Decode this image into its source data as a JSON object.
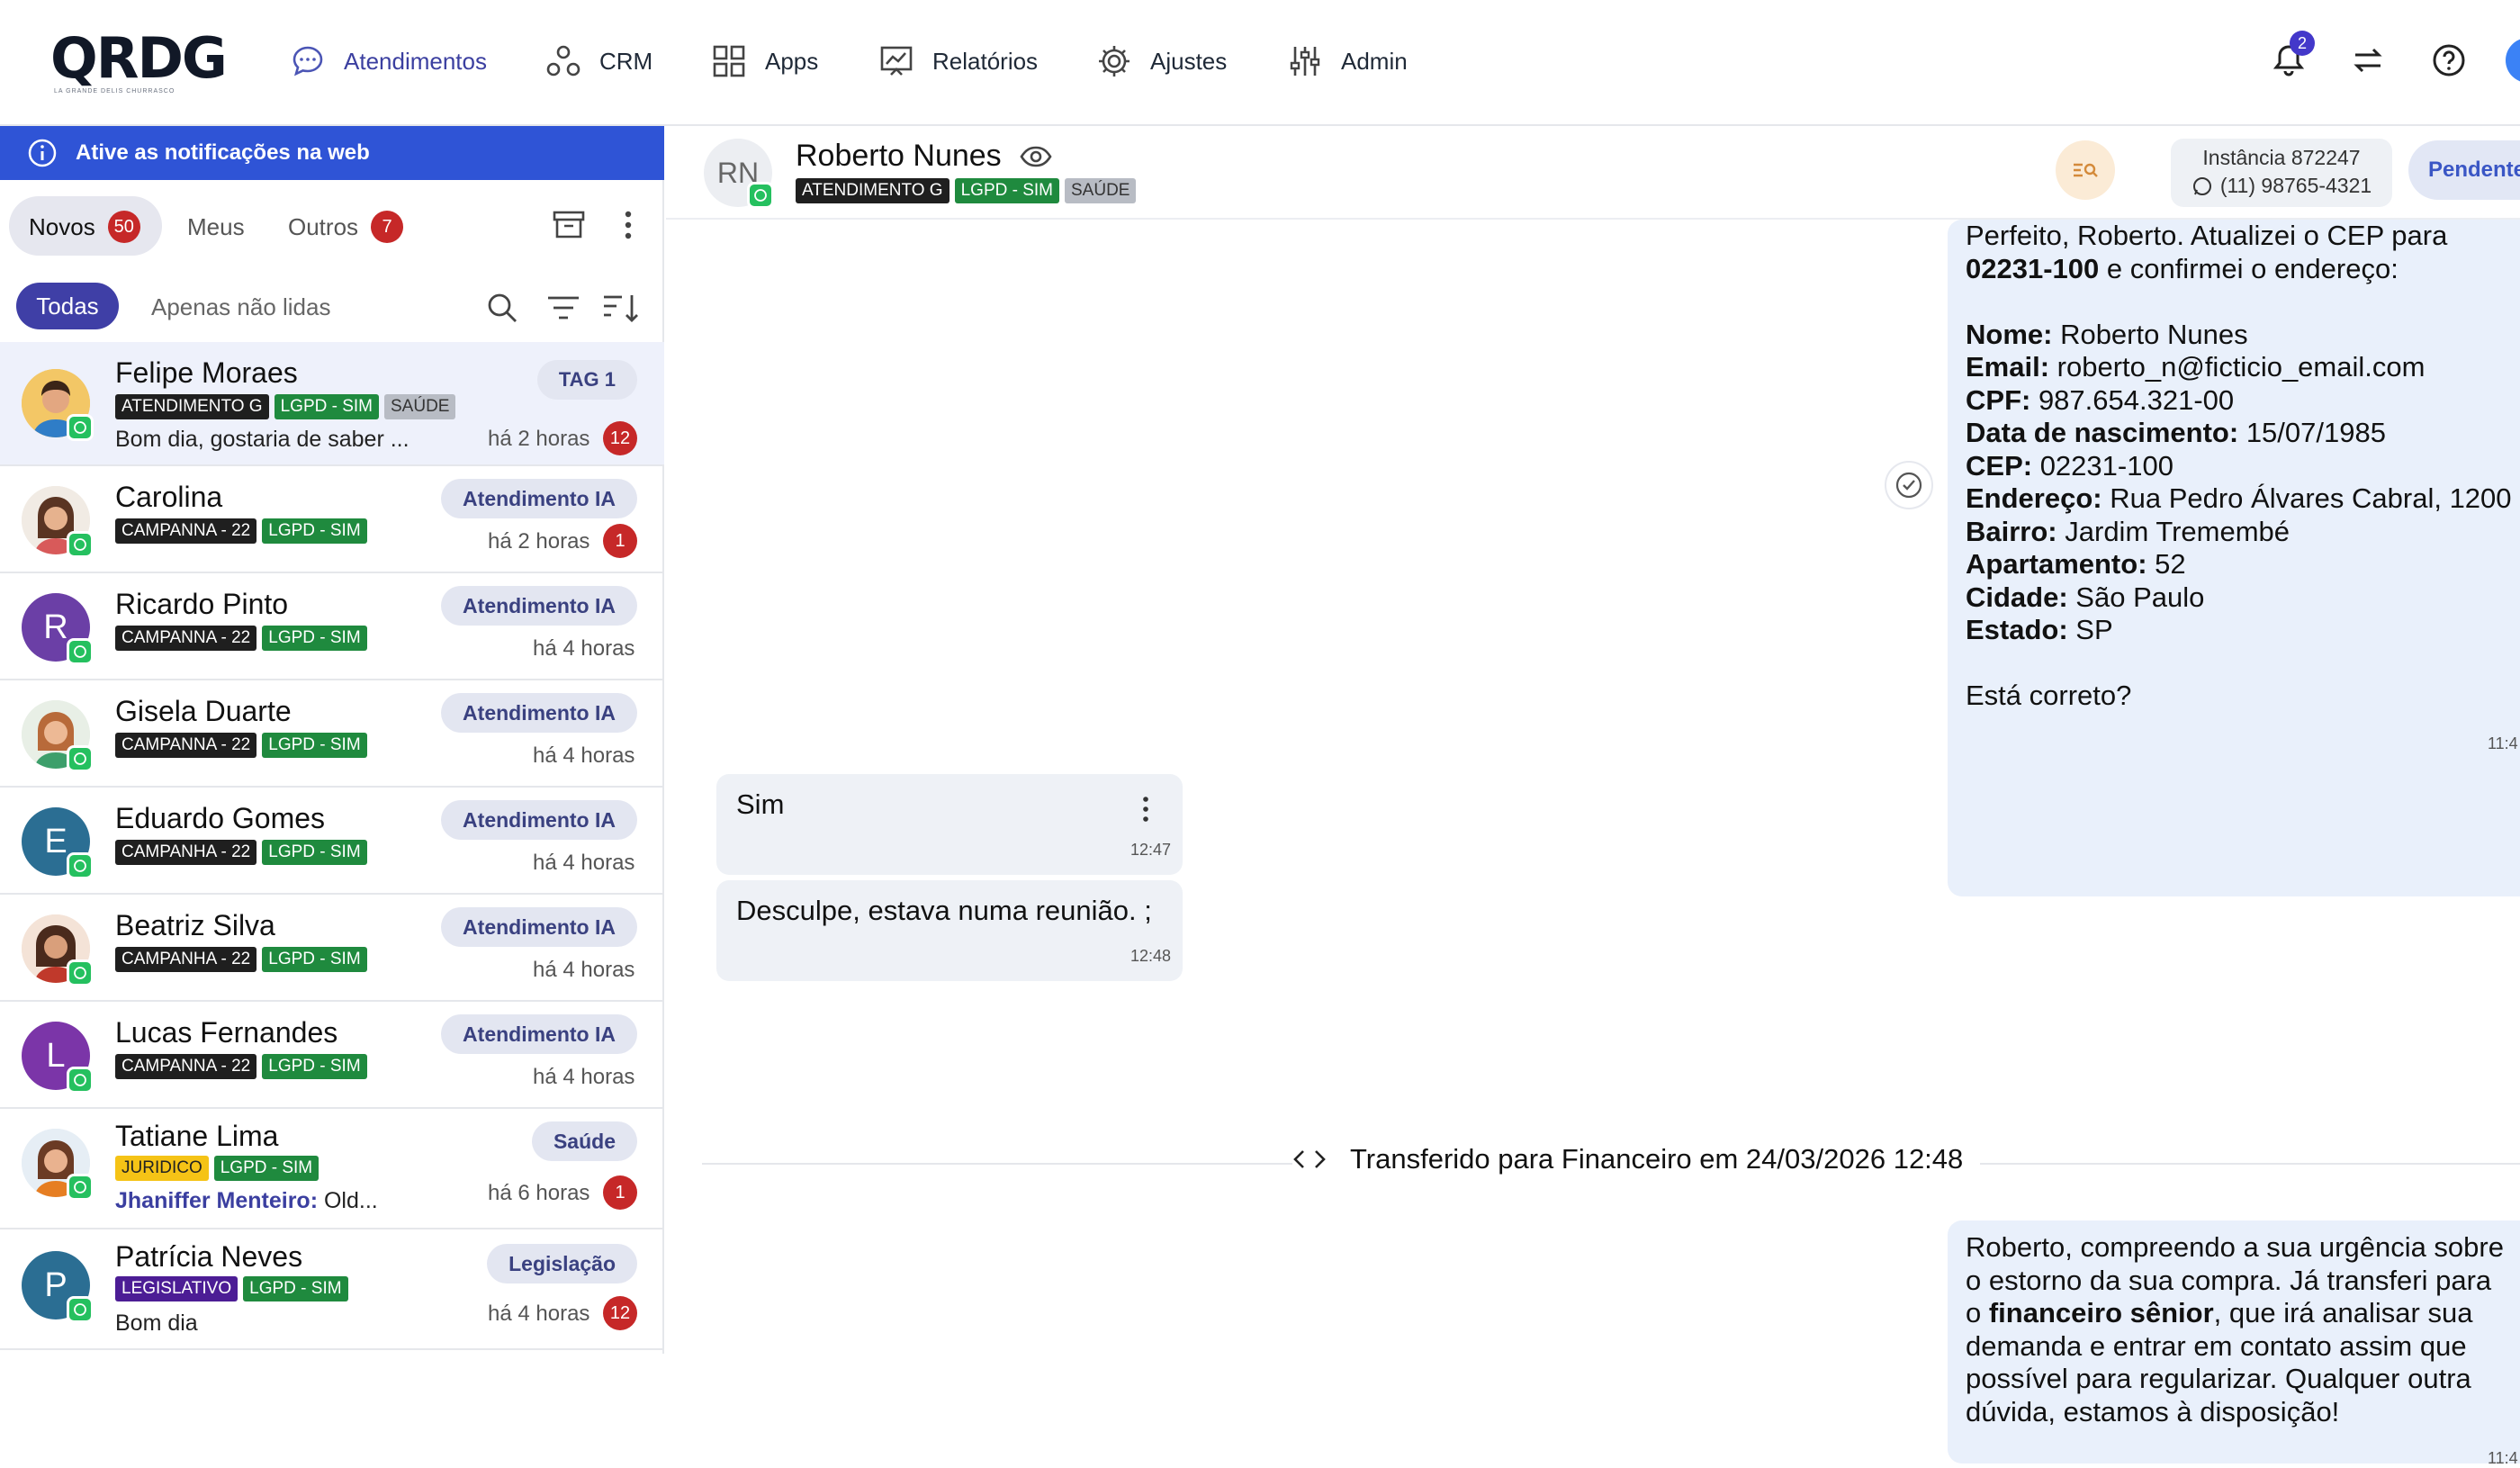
{
  "brand": {
    "logo_text": "QRDG",
    "logo_sub": "LA GRANDE DELIS CHURRASCO"
  },
  "nav": {
    "items": [
      {
        "label": "Atendimentos",
        "icon": "chat-bubble-icon",
        "active": true
      },
      {
        "label": "CRM",
        "icon": "crm-icon"
      },
      {
        "label": "Apps",
        "icon": "apps-grid-icon"
      },
      {
        "label": "Relatórios",
        "icon": "chart-icon"
      },
      {
        "label": "Ajustes",
        "icon": "gear-icon"
      },
      {
        "label": "Admin",
        "icon": "sliders-icon"
      }
    ],
    "notifications_count": "2"
  },
  "left": {
    "banner": "Ative as notificações na web",
    "tabs": [
      {
        "label": "Novos",
        "count": "50"
      },
      {
        "label": "Meus"
      },
      {
        "label": "Outros",
        "count": "7"
      }
    ],
    "filters": {
      "all": "Todas",
      "unread": "Apenas não lidas"
    },
    "contacts": [
      {
        "name": "Felipe Moraes",
        "tags": [
          "ATENDIMENTO G",
          "LGPD - SIM",
          "SAÚDE"
        ],
        "preview": "Bom dia, gostaria de saber ...",
        "pill": "TAG 1",
        "time": "há 2 horas",
        "unread": "12"
      },
      {
        "name": "Carolina",
        "tags": [
          "CAMPANNA - 22",
          "LGPD - SIM"
        ],
        "pill": "Atendimento IA",
        "time": "há 2 horas",
        "unread": "1"
      },
      {
        "name": "Ricardo Pinto",
        "initial": "R",
        "tags": [
          "CAMPANNA - 22",
          "LGPD - SIM"
        ],
        "pill": "Atendimento IA",
        "time": "há 4 horas"
      },
      {
        "name": "Gisela Duarte",
        "tags": [
          "CAMPANNA - 22",
          "LGPD - SIM"
        ],
        "pill": "Atendimento IA",
        "time": "há 4 horas"
      },
      {
        "name": "Eduardo Gomes",
        "initial": "E",
        "tags": [
          "CAMPANHA - 22",
          "LGPD - SIM"
        ],
        "pill": "Atendimento IA",
        "time": "há 4 horas"
      },
      {
        "name": "Beatriz Silva",
        "tags": [
          "CAMPANHA - 22",
          "LGPD - SIM"
        ],
        "pill": "Atendimento IA",
        "time": "há 4 horas"
      },
      {
        "name": "Lucas Fernandes",
        "initial": "L",
        "tags": [
          "CAMPANNA - 22",
          "LGPD - SIM"
        ],
        "pill": "Atendimento IA",
        "time": "há 4 horas"
      },
      {
        "name": "Tatiane Lima",
        "tags": [
          "JURIDICO",
          "LGPD - SIM"
        ],
        "preview_sender": "Jhaniffer Menteiro:",
        "preview": "Old...",
        "pill": "Saúde",
        "time": "há 6 horas",
        "unread": "1"
      },
      {
        "name": "Patrícia Neves",
        "initial": "P",
        "tags": [
          "LEGISLATIVO",
          "LGPD - SIM"
        ],
        "preview": "Bom dia",
        "pill": "Legislação",
        "time": "há 4 horas",
        "unread": "12"
      }
    ]
  },
  "chat": {
    "contact": {
      "initials": "RN",
      "name": "Roberto Nunes",
      "tags": [
        "ATENDIMENTO G",
        "LGPD - SIM",
        "SAÚDE"
      ]
    },
    "instance": {
      "label": "Instância 872247",
      "phone": "(11) 98765-4321"
    },
    "status": "Pendente",
    "msg1": {
      "line1": "Perfeito, Roberto. Atualizei o CEP para",
      "cep": "02231-100",
      "line2_rest": " e confirmei o endereço:",
      "fields": [
        {
          "k": "Nome:",
          "v": " Roberto Nunes"
        },
        {
          "k": "Email:",
          "v": " roberto_n@ficticio_email.com"
        },
        {
          "k": "CPF:",
          "v": " 987.654.321-00"
        },
        {
          "k": "Data de nascimento:",
          "v": " 15/07/1985"
        },
        {
          "k": "CEP:",
          "v": " 02231-100"
        },
        {
          "k": "Endereço:",
          "v": " Rua Pedro Álvares Cabral, 1200"
        },
        {
          "k": "Bairro:",
          "v": " Jardim Tremembé"
        },
        {
          "k": "Apartamento:",
          "v": " 52"
        },
        {
          "k": "Cidade:",
          "v": " São Paulo"
        },
        {
          "k": "Estado:",
          "v": " SP"
        }
      ],
      "question": "Está correto?",
      "time": "11:4"
    },
    "in1": {
      "text": "Sim",
      "time": "12:47"
    },
    "in2": {
      "text": "Desculpe, estava numa reunião. ;",
      "time": "12:48"
    },
    "transfer": "Transferido para Financeiro em 24/03/2026 12:48",
    "msg2": {
      "l1": "Roberto, compreendo a sua urgência sobre",
      "l2": "o estorno da sua compra. Já transferi para",
      "l3a": "o ",
      "l3b": "financeiro sênior",
      "l3c": ", que irá analisar sua",
      "l4": "demanda e entrar em contato assim que",
      "l5": "possível para regularizar. Qualquer outra",
      "l6": "dúvida, estamos à disposição!",
      "time": "11:4"
    }
  }
}
